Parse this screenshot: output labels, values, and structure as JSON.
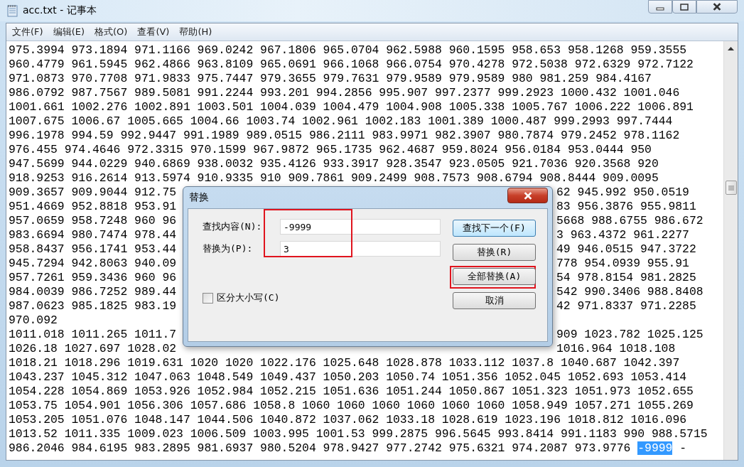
{
  "window": {
    "title": "acc.txt - 记事本"
  },
  "menu": [
    {
      "label": "文件(F)"
    },
    {
      "label": "编辑(E)"
    },
    {
      "label": "格式(O)"
    },
    {
      "label": "查看(V)"
    },
    {
      "label": "帮助(H)"
    }
  ],
  "document": {
    "lines": [
      {
        "text": "975.3994 973.1894 971.1166 969.0242 967.1806 965.0704 962.5988 960.1595 958.653 958.1268 959.3555"
      },
      {
        "text": "960.4779 961.5945 962.4866 963.8109 965.0691 966.1068 966.0754 970.4278 972.5038 972.6329 972.7122"
      },
      {
        "text": "971.0873 970.7708 971.9833 975.7447 979.3655 979.7631 979.9589 979.9589 980 981.259 984.4167"
      },
      {
        "text": "986.0792 987.7567 989.5081 991.2244 993.201 994.2856 995.907 997.2377 999.2923 1000.432 1001.046"
      },
      {
        "text": "1001.661 1002.276 1002.891 1003.501 1004.039 1004.479 1004.908 1005.338 1005.767 1006.222 1006.891"
      },
      {
        "text": "1007.675 1006.67 1005.665 1004.66 1003.74 1002.961 1002.183 1001.389 1000.487 999.2993 997.7444"
      },
      {
        "text": "996.1978 994.59 992.9447 991.1989 989.0515 986.2111 983.9971 982.3907 980.7874 979.2452 978.1162"
      },
      {
        "text": "976.455 974.4646 972.3315 970.1599 967.9872 965.1735 962.4687 959.8024 956.0184 953.0444 950"
      },
      {
        "text": "947.5699 944.0229 940.6869 938.0032 935.4126 933.3917 928.3547 923.0505 921.7036 920.3568 920"
      },
      {
        "text": "918.9253 916.2614 913.5974 910.9335 910 909.7861 909.2499 908.7573 908.6794 908.8444 909.0095"
      },
      {
        "left": "909.3657 909.9044 912.75",
        "right": "62 945.992 950.0519"
      },
      {
        "left": "951.4669 952.8818 953.91",
        "right": "83 956.3876 955.9811"
      },
      {
        "left": "957.0659 958.7248 960 96",
        "right": "5668 988.6755 986.672"
      },
      {
        "left": "983.6694 980.7474 978.44",
        "right": "3 963.4372 961.2277"
      },
      {
        "left": "958.8437 956.1741 953.44",
        "right": "49 946.0515 947.3722"
      },
      {
        "left": "945.7294 942.8063 940.09",
        "right": "778 954.0939 955.91"
      },
      {
        "left": "957.7261 959.3436 960 96",
        "right": "54 978.8154 981.2825"
      },
      {
        "left": "984.0039 986.7252 989.44",
        "right": "542 990.3406 988.8408"
      },
      {
        "left": "987.0623 985.1825 983.19",
        "right": "42 971.8337 971.2285"
      },
      {
        "text": "970.092"
      },
      {
        "left": "1011.018 1011.265 1011.7",
        "right": "909 1023.782 1025.125"
      },
      {
        "left": "1026.18 1027.697 1028.02",
        "right": "1016.964 1018.108"
      },
      {
        "text": "1018.21 1018.296 1019.631 1020 1020 1022.176 1025.648 1028.878 1033.112 1037.8 1040.687 1042.397"
      },
      {
        "text": "1043.237 1045.312 1047.063 1048.549 1049.437 1050.203 1050.74 1051.356 1052.045 1052.693 1053.414"
      },
      {
        "text": "1054.228 1054.869 1053.926 1052.984 1052.215 1051.636 1051.244 1050.867 1051.323 1051.973 1052.655"
      },
      {
        "text": "1053.75 1054.901 1056.306 1057.686 1058.8 1060 1060 1060 1060 1060 1060 1058.949 1057.271 1055.269"
      },
      {
        "text": "1053.205 1051.076 1048.147 1044.506 1040.872 1037.062 1033.18 1028.619 1023.196 1018.812 1016.096"
      },
      {
        "text": "1013.52 1011.335 1009.023 1006.509 1003.995 1001.53 999.2875 996.5645 993.8414 991.1183 990 988.5715"
      },
      {
        "text": "986.2046 984.6195 983.2895 981.6937 980.5204 978.9427 977.2742 975.6321 974.2087 973.9776",
        "selection": "-9999",
        "after": "-"
      }
    ]
  },
  "dialog": {
    "title": "替换",
    "fields_annotated": true,
    "fields": [
      {
        "label": "查找内容(N):",
        "value": "-9999"
      },
      {
        "label": "替换为(P):",
        "value": "3"
      }
    ],
    "checkbox": {
      "label": "区分大小写(C)",
      "checked": false
    },
    "buttons": [
      {
        "label": "查找下一个(F)",
        "default": true,
        "annotated": false
      },
      {
        "label": "替换(R)",
        "default": false,
        "annotated": false
      },
      {
        "label": "全部替换(A)",
        "default": false,
        "annotated": true
      },
      {
        "label": "取消",
        "default": false,
        "annotated": false
      }
    ]
  }
}
